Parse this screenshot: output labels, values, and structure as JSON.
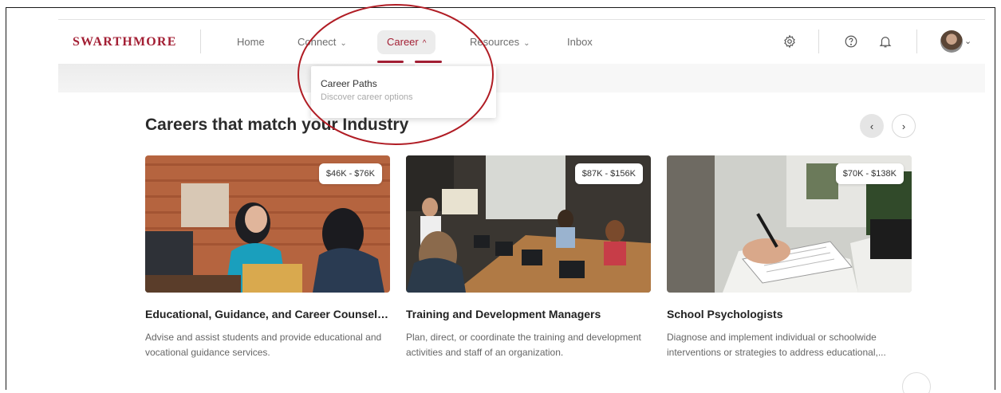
{
  "brand": {
    "logo_text": "SWARTHMORE"
  },
  "nav": {
    "items": [
      {
        "label": "Home",
        "has_chevron": false
      },
      {
        "label": "Connect",
        "has_chevron": true
      },
      {
        "label": "Career",
        "has_chevron": true,
        "active": true
      },
      {
        "label": "Resources",
        "has_chevron": true
      },
      {
        "label": "Inbox",
        "has_chevron": false
      }
    ],
    "chevron_down": "⌄",
    "chevron_up": "^",
    "icons": [
      "gear-icon",
      "help-icon",
      "bell-icon",
      "avatar"
    ]
  },
  "dropdown": {
    "title": "Career Paths",
    "subtitle": "Discover career options"
  },
  "section": {
    "title": "Careers that match your Industry",
    "prev_glyph": "‹",
    "next_glyph": "›"
  },
  "cards": [
    {
      "salary": "$46K - $76K",
      "title": "Educational, Guidance, and Career Counselo...",
      "description": "Advise and assist students and provide educational and vocational guidance services."
    },
    {
      "salary": "$87K - $156K",
      "title": "Training and Development Managers",
      "description": "Plan, direct, or coordinate the training and development activities and staff of an organization."
    },
    {
      "salary": "$70K - $138K",
      "title": "School Psychologists",
      "description": "Diagnose and implement individual or schoolwide interventions or strategies to address educational,..."
    }
  ],
  "colors": {
    "brand": "#a31f34",
    "annotation": "#b01c24"
  }
}
